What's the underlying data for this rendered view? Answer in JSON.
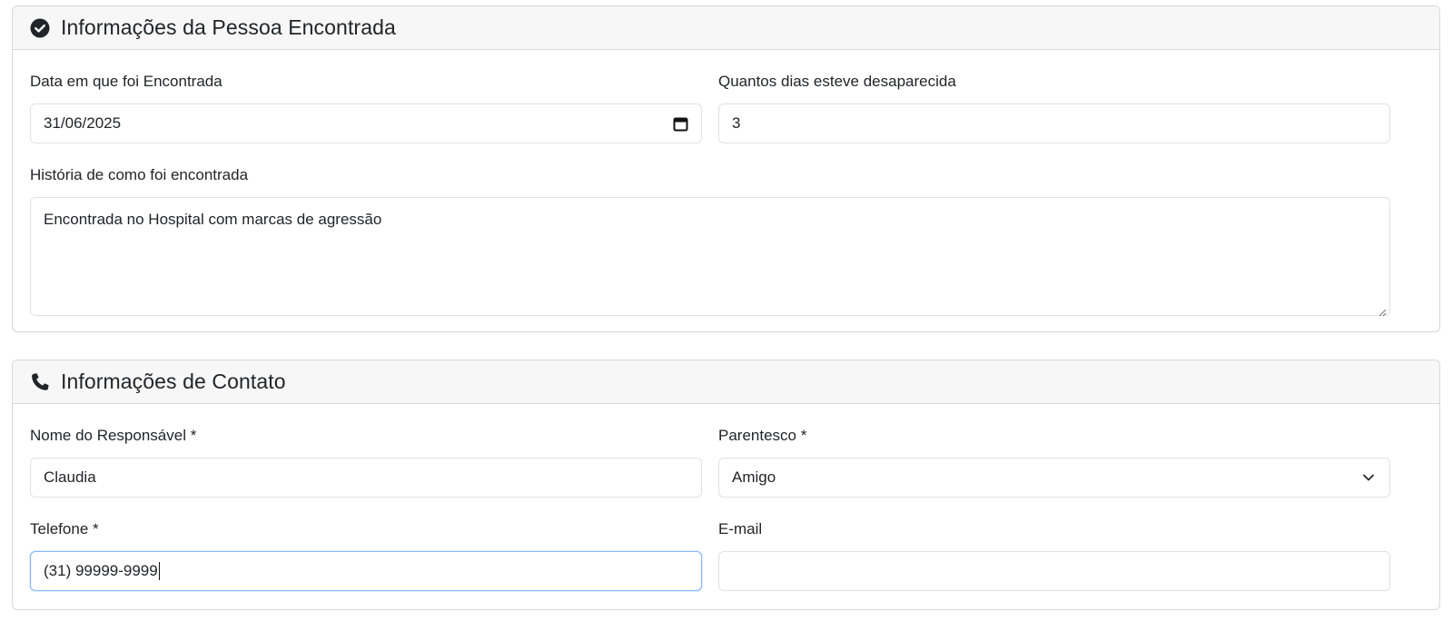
{
  "found_section": {
    "title": "Informações da Pessoa Encontrada",
    "icon": "check-circle-icon",
    "date_label": "Data em que foi Encontrada",
    "date_value": "31/06/2025",
    "days_label": "Quantos dias esteve desaparecida",
    "days_value": "3",
    "story_label": "História de como foi encontrada",
    "story_value": "Encontrada no Hospital com marcas de agressão"
  },
  "contact_section": {
    "title": "Informações de Contato",
    "icon": "phone-icon",
    "responsible_label": "Nome do Responsável *",
    "responsible_value": "Claudia",
    "relationship_label": "Parentesco *",
    "relationship_value": "Amigo",
    "phone_label": "Telefone *",
    "phone_value": "(31) 99999-9999",
    "email_label": "E-mail",
    "email_value": ""
  },
  "colors": {
    "header_bg": "#f7f7f7",
    "border": "#dee2e6",
    "focus_border": "#86b7fe",
    "text": "#212529"
  }
}
